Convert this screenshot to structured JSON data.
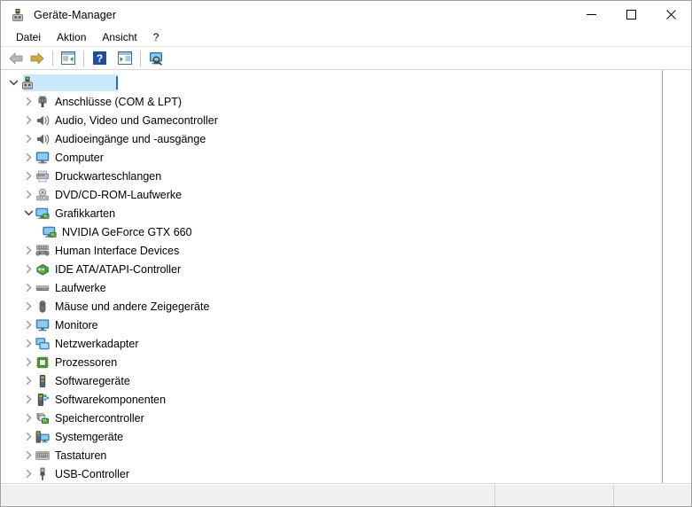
{
  "window": {
    "title": "Geräte-Manager",
    "title_icon": "device-manager-icon",
    "controls": {
      "minimize": "minimize-icon",
      "maximize": "maximize-icon",
      "close": "close-icon"
    }
  },
  "menubar": {
    "items": [
      {
        "label": "Datei"
      },
      {
        "label": "Aktion"
      },
      {
        "label": "Ansicht"
      },
      {
        "label": "?"
      }
    ]
  },
  "toolbar": {
    "buttons": [
      {
        "name": "back-button",
        "icon": "back-arrow-icon"
      },
      {
        "name": "forward-button",
        "icon": "forward-arrow-icon"
      },
      {
        "name": "properties-button",
        "icon": "window-properties-icon"
      },
      {
        "name": "help-button",
        "icon": "question-mark-icon"
      },
      {
        "name": "show-hidden-button",
        "icon": "window-play-icon"
      },
      {
        "name": "scan-hardware-button",
        "icon": "monitor-scan-icon"
      }
    ]
  },
  "tree": {
    "root": {
      "label": "",
      "icon": "computer-root-icon",
      "expanded": true,
      "selected": true,
      "editing": true
    },
    "items": [
      {
        "label": "Anschlüsse (COM & LPT)",
        "icon": "ports-icon",
        "level": 1,
        "expandable": true,
        "expanded": false
      },
      {
        "label": "Audio, Video und Gamecontroller",
        "icon": "speaker-icon",
        "level": 1,
        "expandable": true,
        "expanded": false
      },
      {
        "label": "Audioeingänge und -ausgänge",
        "icon": "speaker-icon",
        "level": 1,
        "expandable": true,
        "expanded": false
      },
      {
        "label": "Computer",
        "icon": "monitor-icon",
        "level": 1,
        "expandable": true,
        "expanded": false
      },
      {
        "label": "Druckwarteschlangen",
        "icon": "printer-icon",
        "level": 1,
        "expandable": true,
        "expanded": false
      },
      {
        "label": "DVD/CD-ROM-Laufwerke",
        "icon": "disc-drive-icon",
        "level": 1,
        "expandable": true,
        "expanded": false
      },
      {
        "label": "Grafikkarten",
        "icon": "display-adapter-icon",
        "level": 1,
        "expandable": true,
        "expanded": true
      },
      {
        "label": "NVIDIA GeForce GTX 660",
        "icon": "display-adapter-icon",
        "level": 2,
        "expandable": false,
        "expanded": false
      },
      {
        "label": "Human Interface Devices",
        "icon": "hid-gamepad-icon",
        "level": 1,
        "expandable": true,
        "expanded": false
      },
      {
        "label": "IDE ATA/ATAPI-Controller",
        "icon": "ide-controller-icon",
        "level": 1,
        "expandable": true,
        "expanded": false
      },
      {
        "label": "Laufwerke",
        "icon": "disk-drive-icon",
        "level": 1,
        "expandable": true,
        "expanded": false
      },
      {
        "label": "Mäuse und andere Zeigegeräte",
        "icon": "mouse-icon",
        "level": 1,
        "expandable": true,
        "expanded": false
      },
      {
        "label": "Monitore",
        "icon": "monitor-icon",
        "level": 1,
        "expandable": true,
        "expanded": false
      },
      {
        "label": "Netzwerkadapter",
        "icon": "network-adapter-icon",
        "level": 1,
        "expandable": true,
        "expanded": false
      },
      {
        "label": "Prozessoren",
        "icon": "processor-icon",
        "level": 1,
        "expandable": true,
        "expanded": false
      },
      {
        "label": "Softwaregeräte",
        "icon": "software-device-icon",
        "level": 1,
        "expandable": true,
        "expanded": false
      },
      {
        "label": "Softwarekomponenten",
        "icon": "software-component-icon",
        "level": 1,
        "expandable": true,
        "expanded": false
      },
      {
        "label": "Speichercontroller",
        "icon": "storage-controller-icon",
        "level": 1,
        "expandable": true,
        "expanded": false
      },
      {
        "label": "Systemgeräte",
        "icon": "system-device-icon",
        "level": 1,
        "expandable": true,
        "expanded": false
      },
      {
        "label": "Tastaturen",
        "icon": "keyboard-icon",
        "level": 1,
        "expandable": true,
        "expanded": false
      },
      {
        "label": "USB-Controller",
        "icon": "usb-icon",
        "level": 1,
        "expandable": true,
        "expanded": false
      }
    ]
  },
  "statusbar": {
    "pane1": "",
    "pane2": "",
    "pane3": ""
  },
  "colors": {
    "selection": "#cce8ff",
    "caret": "#1a72c8",
    "window_bg": "#ffffff",
    "statusbar_bg": "#f0f0f0"
  }
}
